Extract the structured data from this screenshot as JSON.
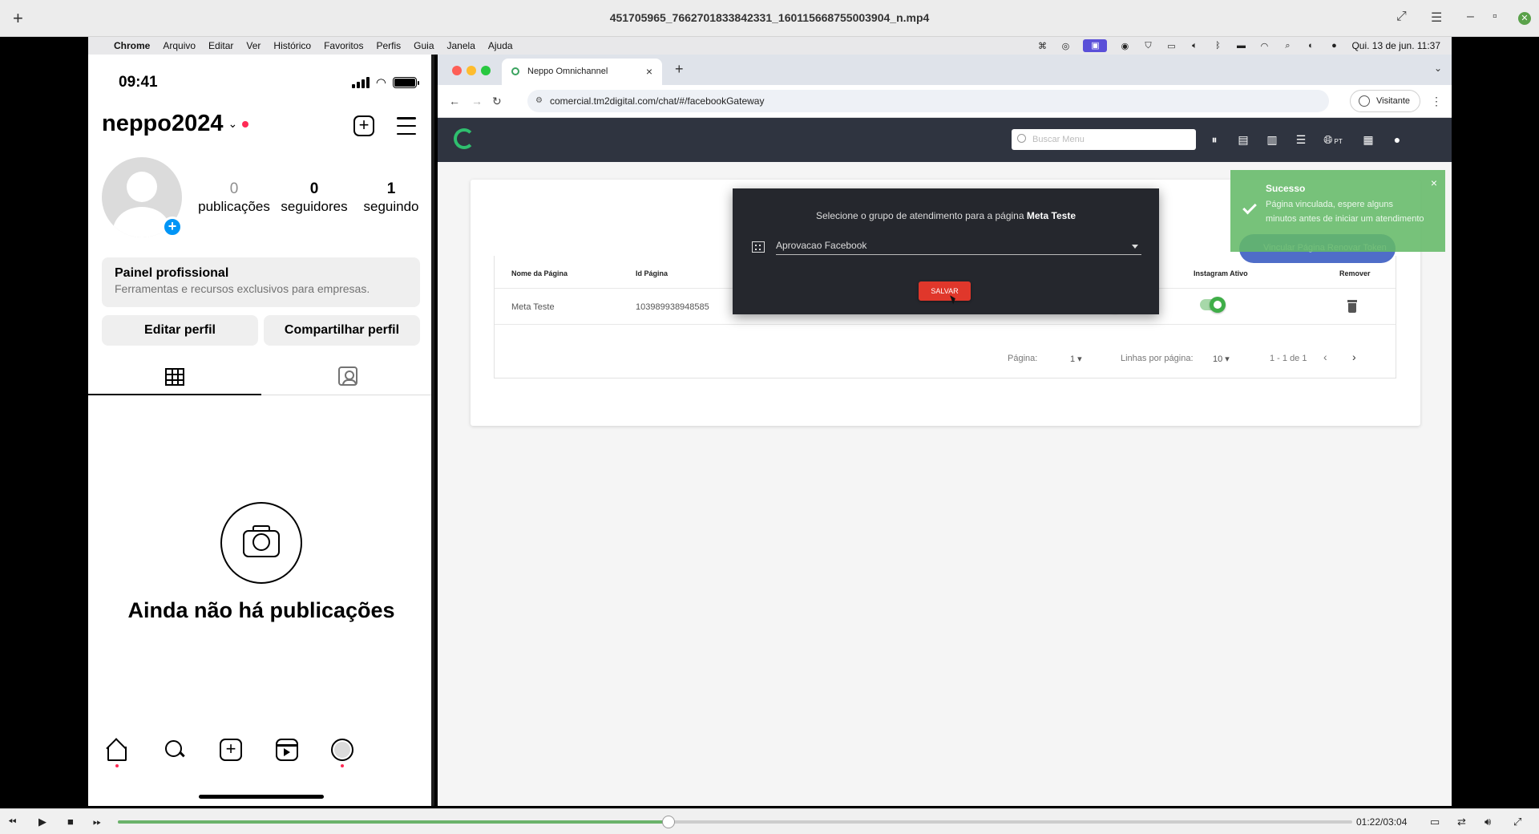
{
  "player": {
    "filename": "451705965_7662701833842331_160115668755003904_n.mp4",
    "time": "01:22/03:04",
    "progress": 0.446
  },
  "mac_menubar": {
    "app": "Chrome",
    "items": [
      "Arquivo",
      "Editar",
      "Ver",
      "Histórico",
      "Favoritos",
      "Perfis",
      "Guia",
      "Janela",
      "Ajuda"
    ],
    "datetime": "Qui. 13 de jun.  11:37"
  },
  "phone": {
    "time": "09:41",
    "username": "neppo2024",
    "stats": [
      {
        "value": "0",
        "label": "publicações"
      },
      {
        "value": "0",
        "label": "seguidores"
      },
      {
        "value": "1",
        "label": "seguindo"
      }
    ],
    "panel_title": "Painel profissional",
    "panel_subtitle": "Ferramentas e recursos exclusivos para empresas.",
    "edit_profile": "Editar perfil",
    "share_profile": "Compartilhar perfil",
    "empty_text": "Ainda não há publicações"
  },
  "browser": {
    "tab_title": "Neppo Omnichannel",
    "url": "comercial.tm2digital.com/chat/#/facebookGateway",
    "guest_label": "Visitante"
  },
  "app": {
    "search_placeholder": "Buscar Menu",
    "lang": "PT",
    "table": {
      "headers": {
        "page_name": "Nome da Página",
        "page_id": "Id Página",
        "instagram": "Instagram Ativo",
        "remove": "Remover"
      },
      "rows": [
        {
          "page_name": "Meta Teste",
          "page_id": "103989938948585"
        }
      ]
    },
    "pagination": {
      "page_label": "Página:",
      "page_value": "1",
      "rows_label": "Linhas por página:",
      "rows_value": "10",
      "range": "1 - 1 de 1"
    },
    "modal": {
      "message_prefix": "Selecione o grupo de atendimento para a página ",
      "message_page": "Meta Teste",
      "selected_group": "Aprovacao Facebook",
      "save_label": "SALVAR"
    },
    "blue_button": "Vincular Página Renovar Token",
    "toast": {
      "title": "Sucesso",
      "text": "Página vinculada, espere alguns minutos antes de iniciar um atendimento"
    }
  },
  "colors": {
    "accent_green": "#3fae48",
    "modal_bg": "#25272d",
    "save_red": "#e0372b",
    "header_bg": "#2f3440",
    "instagram_blue": "#0095f6"
  }
}
